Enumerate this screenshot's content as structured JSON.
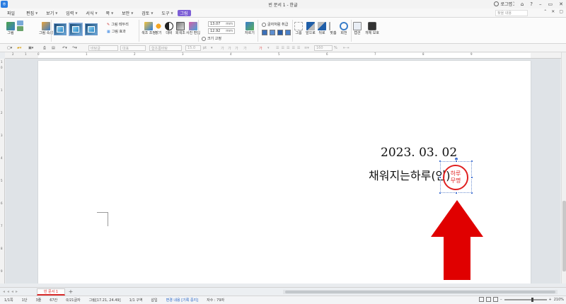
{
  "window": {
    "app_icon": "ㅎ",
    "title": "빈 문서 1 - 한글",
    "login": "로그인",
    "buttons": [
      "⛶",
      "⌂",
      "?",
      "–",
      "▭",
      "✕"
    ]
  },
  "menubar": {
    "file": "파일",
    "items": [
      "편집",
      "보기",
      "입력",
      "서식",
      "쪽",
      "보안",
      "검토",
      "도구"
    ],
    "active": "그림",
    "search_placeholder": "찾을 내용",
    "right_icons": [
      "⌃",
      "✕",
      "▢"
    ]
  },
  "ribbon": {
    "group1": [
      "그림",
      "그림 속성"
    ],
    "style_labels": [
      "그림 테두리",
      "그림 효과"
    ],
    "adjust": [
      "색조 조정",
      "밝기",
      "대비",
      "회색조",
      "사진 편집"
    ],
    "width_value": "13.07",
    "height_value": "12.92",
    "unit": "mm",
    "size_fix": "크기 고정",
    "crop": "자르기",
    "wrap_label": "글자처럼 취급",
    "arrange": [
      "그룹",
      "앞으로",
      "뒤로",
      "맞춤",
      "회전"
    ],
    "caption": [
      "캡션",
      "개체 보호"
    ]
  },
  "toolbar2": {
    "style": "바탕글",
    "lang": "대표",
    "font": "함초롬바탕",
    "size": "15.0",
    "unit": "pt",
    "zoom_pct": "160",
    "pct": "%"
  },
  "ruler": {
    "numbers": [
      "2",
      "1",
      "0",
      "1",
      "2",
      "3",
      "4",
      "5",
      "6",
      "7",
      "8",
      "9"
    ]
  },
  "vruler": {
    "numbers": [
      "1",
      "0",
      "1",
      "2",
      "3",
      "4",
      "5",
      "6",
      "7",
      "8",
      "9"
    ]
  },
  "document": {
    "date": "2023. 03. 02",
    "signer": "채워지는하루(인)",
    "stamp_line1": "하루",
    "stamp_line2": "무명"
  },
  "tabs": {
    "doc_tab": "빈 문서 1",
    "add": "+"
  },
  "status": {
    "items": [
      {
        "text": "1/1쪽",
        "blue": false
      },
      {
        "text": "1단",
        "blue": false
      },
      {
        "text": "3줄",
        "blue": false
      },
      {
        "text": "67칸",
        "blue": false
      },
      {
        "text": "0/21글자",
        "blue": false
      },
      {
        "text": "그림[17.21, 24.49]",
        "blue": false
      },
      {
        "text": "1/1 구역",
        "blue": false
      },
      {
        "text": "삽입",
        "blue": false
      },
      {
        "text": "변경 내용 [기록 중지]",
        "blue": true
      },
      {
        "text": "자수 : 79자",
        "blue": false
      }
    ],
    "zoom": "210%"
  },
  "colors": {
    "accent": "#7d5fd6",
    "stamp_red": "#e02020",
    "arrow_red": "#e00000",
    "selection_blue": "#3f6fd1"
  }
}
